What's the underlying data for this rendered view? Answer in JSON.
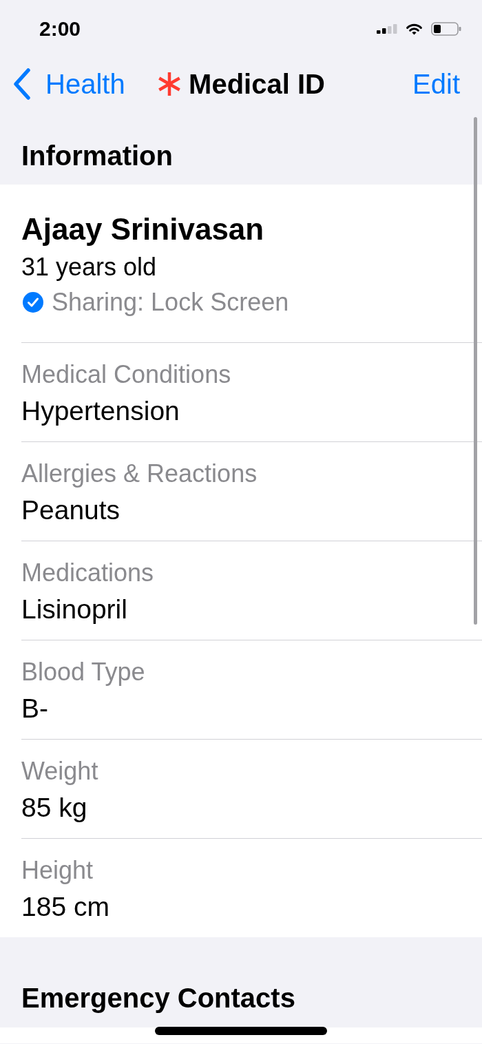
{
  "status_bar": {
    "time": "2:00"
  },
  "nav_bar": {
    "back_label": "Health",
    "title": "Medical ID",
    "action_label": "Edit"
  },
  "information": {
    "heading": "Information",
    "name": "Ajaay Srinivasan",
    "age": "31 years old",
    "sharing": {
      "label": "Sharing: Lock Screen",
      "checked": true
    },
    "fields": [
      {
        "label": "Medical Conditions",
        "value": "Hypertension"
      },
      {
        "label": "Allergies & Reactions",
        "value": "Peanuts"
      },
      {
        "label": "Medications",
        "value": "Lisinopril"
      },
      {
        "label": "Blood Type",
        "value": "B-"
      },
      {
        "label": "Weight",
        "value": "85 kg"
      },
      {
        "label": "Height",
        "value": "185 cm"
      }
    ]
  },
  "emergency_contacts": {
    "heading": "Emergency Contacts"
  }
}
